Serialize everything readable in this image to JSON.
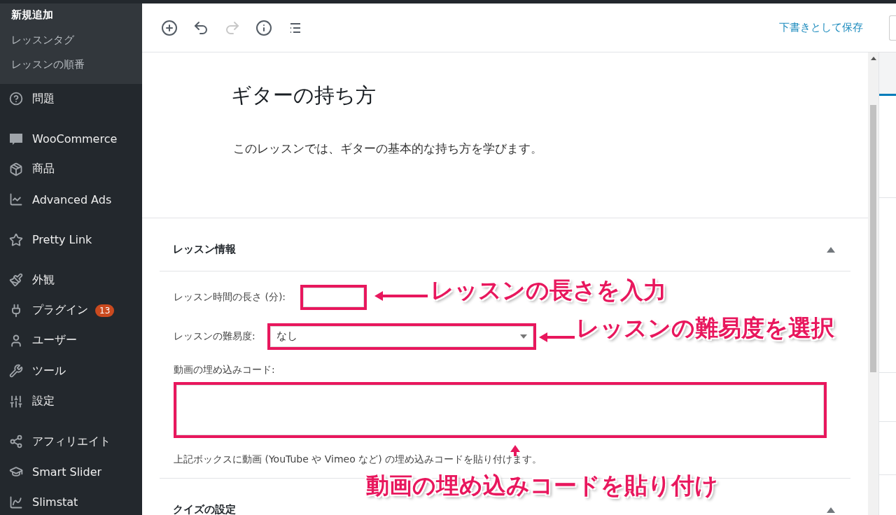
{
  "sidebar": {
    "submenu": [
      {
        "label": "新規追加",
        "selected": true
      },
      {
        "label": "レッスンタグ",
        "selected": false
      },
      {
        "label": "レッスンの順番",
        "selected": false
      }
    ],
    "groups": [
      [
        {
          "label": "問題"
        }
      ],
      [
        {
          "label": "WooCommerce"
        },
        {
          "label": "商品"
        },
        {
          "label": "Advanced Ads"
        }
      ],
      [
        {
          "label": "Pretty Link"
        }
      ],
      [
        {
          "label": "外観"
        },
        {
          "label": "プラグイン",
          "badge": "13"
        },
        {
          "label": "ユーザー"
        },
        {
          "label": "ツール"
        },
        {
          "label": "設定"
        }
      ],
      [
        {
          "label": "アフィリエイト"
        },
        {
          "label": "Smart Slider"
        },
        {
          "label": "Slimstat"
        }
      ]
    ]
  },
  "toolbar": {
    "buttons": [
      {
        "disabled": false
      },
      {
        "disabled": false
      },
      {
        "disabled": true
      },
      {
        "disabled": false
      },
      {
        "disabled": false
      }
    ],
    "save_draft": "下書きとして保存"
  },
  "post": {
    "title": "ギターの持ち方",
    "paragraph": "このレッスンでは、ギターの基本的な持ち方を学びます。"
  },
  "metaboxes": [
    {
      "title": "レッスン情報",
      "expanded": true,
      "fields": [
        {
          "kind": "number",
          "label": "レッスン時間の長さ (分):"
        },
        {
          "kind": "select",
          "label": "レッスンの難易度:",
          "value": "なし"
        },
        {
          "kind": "textarea",
          "label": "動画の埋め込みコード:",
          "help": "上記ボックスに動画 (YouTube や Vimeo など) の埋め込みコードを貼り付けます。"
        }
      ]
    },
    {
      "title": "クイズの設定",
      "expanded": true
    }
  ],
  "annotations": [
    {
      "text": "レッスンの長さを入力"
    },
    {
      "text": "レッスンの難易度を選択"
    },
    {
      "text": "動画の埋め込みコードを貼り付け"
    }
  ]
}
